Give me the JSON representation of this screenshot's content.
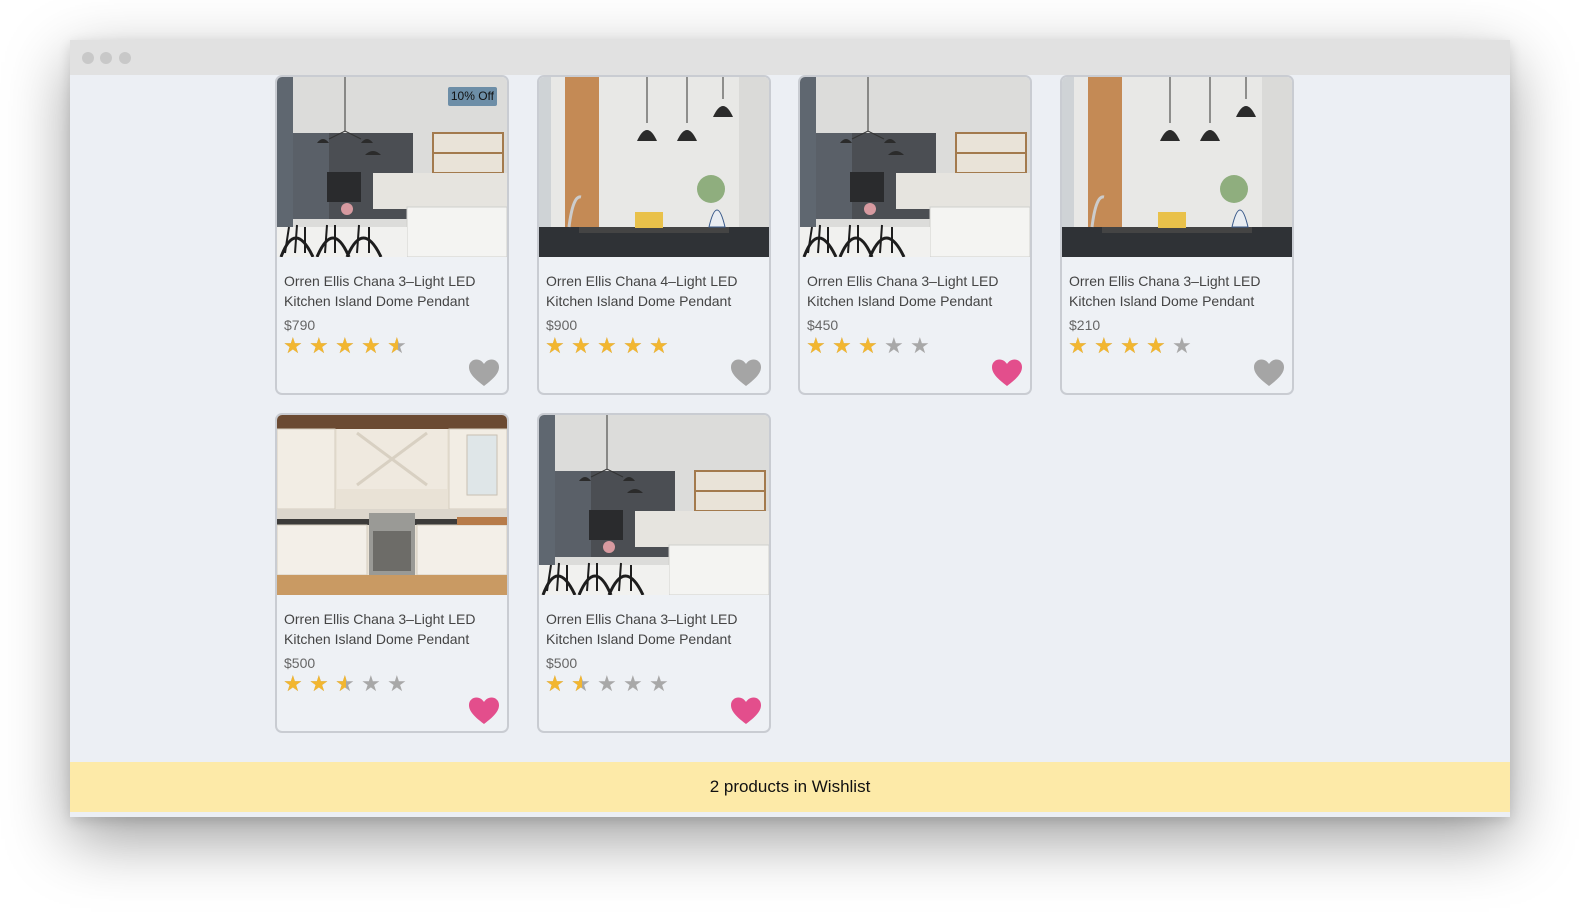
{
  "wishlist": {
    "summary": "2 products in Wishlist"
  },
  "colors": {
    "star_on": "#f2b630",
    "star_off": "#a8a8a8",
    "heart_on": "#e34e8c",
    "heart_off": "#a5a5a5"
  },
  "products": [
    {
      "title": "Orren Ellis Chana 3–Light LED Kitchen Island Dome Pendant",
      "price": "$790",
      "rating": 4.5,
      "badge": "10% Off",
      "wishlisted": false,
      "image": "kitchen-dark-cabinets-pendants"
    },
    {
      "title": "Orren Ellis Chana 4–Light LED Kitchen Island Dome Pendant",
      "price": "$900",
      "rating": 5,
      "badge": "",
      "wishlisted": false,
      "image": "kitchen-black-dome-pendants"
    },
    {
      "title": "Orren Ellis Chana 3–Light LED Kitchen Island Dome Pendant",
      "price": "$450",
      "rating": 3,
      "badge": "",
      "wishlisted": true,
      "image": "kitchen-dark-cabinets-pendants"
    },
    {
      "title": "Orren Ellis Chana 3–Light LED Kitchen Island Dome Pendant",
      "price": "$210",
      "rating": 4,
      "badge": "",
      "wishlisted": false,
      "image": "kitchen-black-dome-pendants"
    },
    {
      "title": "Orren Ellis Chana 3–Light LED Kitchen Island Dome Pendant",
      "price": "$500",
      "rating": 2.5,
      "badge": "",
      "wishlisted": true,
      "image": "kitchen-white-cabinets-stove"
    },
    {
      "title": "Orren Ellis Chana 3–Light LED Kitchen Island Dome Pendant",
      "price": "$500",
      "rating": 1.5,
      "badge": "",
      "wishlisted": true,
      "image": "kitchen-dark-cabinets-pendants"
    }
  ]
}
